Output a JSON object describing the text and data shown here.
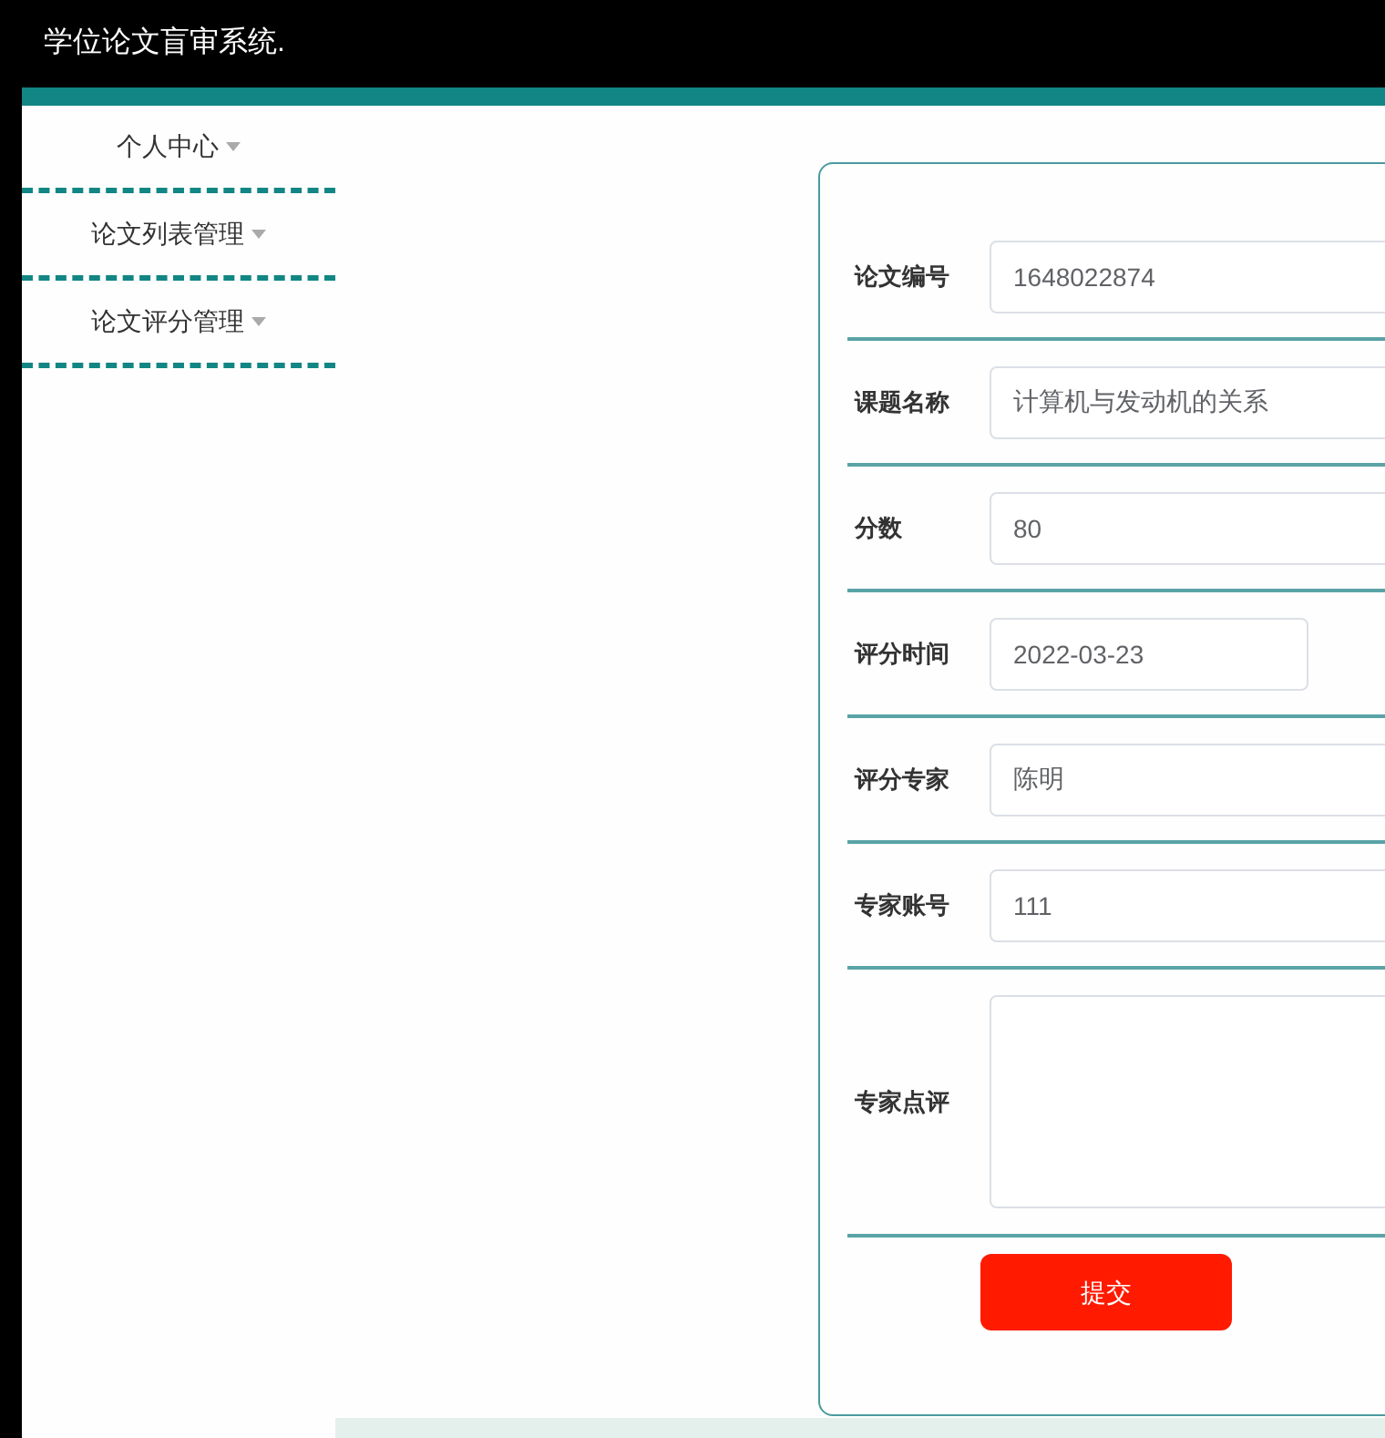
{
  "header": {
    "title": "学位论文盲审系统."
  },
  "sidebar": {
    "items": [
      {
        "label": "个人中心"
      },
      {
        "label": "论文列表管理"
      },
      {
        "label": "论文评分管理"
      }
    ]
  },
  "form": {
    "fields": [
      {
        "kind": "text",
        "label": "论文编号",
        "value": "1648022874"
      },
      {
        "kind": "text",
        "label": "课题名称",
        "value": "计算机与发动机的关系"
      },
      {
        "kind": "text",
        "label": "分数",
        "value": "80"
      },
      {
        "kind": "date",
        "label": "评分时间",
        "value": "2022-03-23"
      },
      {
        "kind": "text",
        "label": "评分专家",
        "value": "陈明"
      },
      {
        "kind": "text",
        "label": "专家账号",
        "value": "111"
      },
      {
        "kind": "textarea",
        "label": "专家点评"
      }
    ],
    "submit": "提交"
  }
}
